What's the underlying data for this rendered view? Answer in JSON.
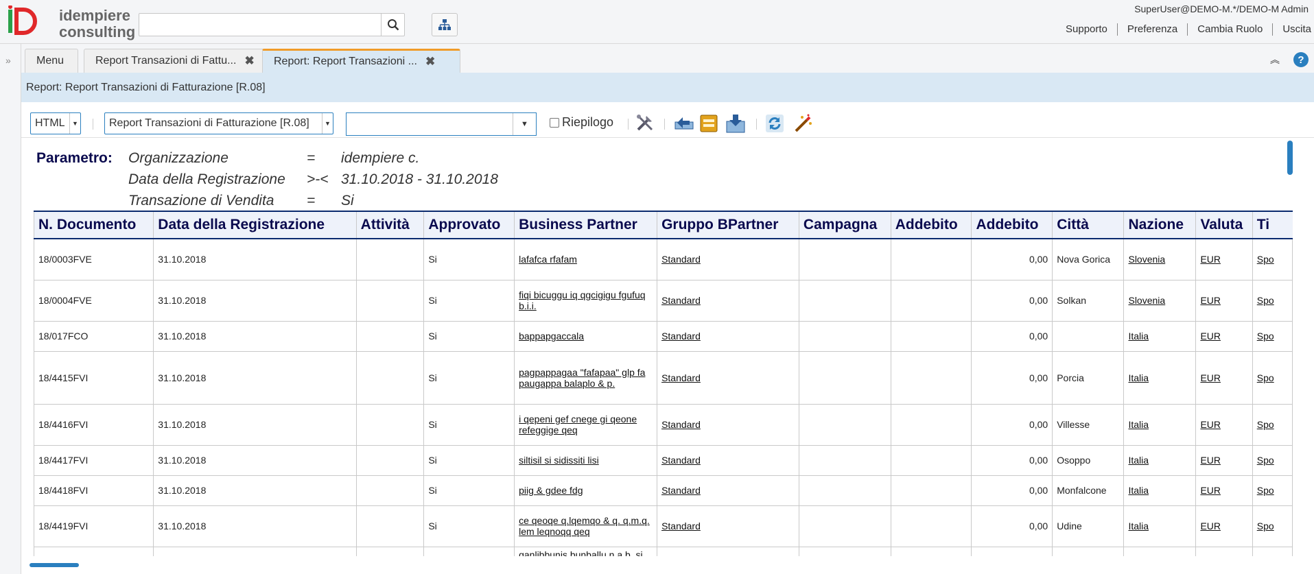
{
  "header": {
    "logo_top": "idempiere",
    "logo_bottom": "consulting",
    "search_placeholder": "",
    "user": "SuperUser@DEMO-M.*/DEMO-M Admin",
    "links": [
      "Supporto",
      "Preferenza",
      "Cambia Ruolo",
      "Uscita"
    ]
  },
  "tabs": [
    {
      "label": "Menu",
      "closable": false,
      "active": false
    },
    {
      "label": "Report Transazioni di Fattu...",
      "closable": true,
      "active": false
    },
    {
      "label": "Report: Report Transazioni ...",
      "closable": true,
      "active": true
    }
  ],
  "window_title": "Report: Report Transazioni di Fatturazione [R.08]",
  "toolbar": {
    "format": "HTML",
    "report_view": "Report Transazioni di Fatturazione [R.08]",
    "print_format": "",
    "summary_label": "Riepilogo",
    "summary_checked": false
  },
  "params": {
    "label": "Parametro:",
    "rows": [
      {
        "name": "Organizzazione",
        "op": "=",
        "value": "idempiere c."
      },
      {
        "name": "Data della Registrazione",
        "op": ">-<",
        "value": "31.10.2018 - 31.10.2018"
      },
      {
        "name": "Transazione di Vendita",
        "op": "=",
        "value": "Si"
      }
    ]
  },
  "table": {
    "columns": [
      "N. Documento",
      "Data della Registrazione",
      "Attività",
      "Approvato",
      "Business Partner",
      "Gruppo BPartner",
      "Campagna",
      "Addebito",
      "Addebito",
      "Città",
      "Nazione",
      "Valuta",
      "Ti"
    ],
    "rows": [
      {
        "doc": "18/0003FVE",
        "date": "31.10.2018",
        "approved": "Si",
        "bp": "lafafca rfafam",
        "group": "Standard",
        "debit": "0,00",
        "city": "Nova Gorica",
        "country": "Slovenia",
        "currency": "EUR",
        "type": "Spo"
      },
      {
        "doc": "18/0004FVE",
        "date": "31.10.2018",
        "approved": "Si",
        "bp": "fiqi bicuggu iq qgcigigu fgufuq b.i.i.",
        "group": "Standard",
        "debit": "0,00",
        "city": "Solkan",
        "country": "Slovenia",
        "currency": "EUR",
        "type": "Spo"
      },
      {
        "doc": "18/017FCO",
        "date": "31.10.2018",
        "approved": "Si",
        "bp": "bappapgaccala",
        "group": "Standard",
        "debit": "0,00",
        "city": "",
        "country": "Italia",
        "currency": "EUR",
        "type": "Spo"
      },
      {
        "doc": "18/4415FVI",
        "date": "31.10.2018",
        "approved": "Si",
        "bp": "pagpappagaa \"fafapaa\" glp fa paugappa balaplo & p.",
        "group": "Standard",
        "debit": "0,00",
        "city": "Porcia",
        "country": "Italia",
        "currency": "EUR",
        "type": "Spo"
      },
      {
        "doc": "18/4416FVI",
        "date": "31.10.2018",
        "approved": "Si",
        "bp": "i qepeni gef cnege gi qeone refeggige qeq",
        "group": "Standard",
        "debit": "0,00",
        "city": "Villesse",
        "country": "Italia",
        "currency": "EUR",
        "type": "Spo"
      },
      {
        "doc": "18/4417FVI",
        "date": "31.10.2018",
        "approved": "Si",
        "bp": "siltisil si sidissiti lisi",
        "group": "Standard",
        "debit": "0,00",
        "city": "Osoppo",
        "country": "Italia",
        "currency": "EUR",
        "type": "Spo"
      },
      {
        "doc": "18/4418FVI",
        "date": "31.10.2018",
        "approved": "Si",
        "bp": "piig & gdee fdg",
        "group": "Standard",
        "debit": "0,00",
        "city": "Monfalcone",
        "country": "Italia",
        "currency": "EUR",
        "type": "Spo"
      },
      {
        "doc": "18/4419FVI",
        "date": "31.10.2018",
        "approved": "Si",
        "bp": "ce qeoqe q.lqemqo & q. q.m.q. lem leqnoqq qeq",
        "group": "Standard",
        "debit": "0,00",
        "city": "Udine",
        "country": "Italia",
        "currency": "EUR",
        "type": "Spo"
      },
      {
        "doc": "",
        "date": "",
        "approved": "",
        "bp": "ganlibbunis bunballu n.a.b. si",
        "group": "",
        "debit": "",
        "city": "",
        "country": "",
        "currency": "",
        "type": ""
      }
    ]
  }
}
